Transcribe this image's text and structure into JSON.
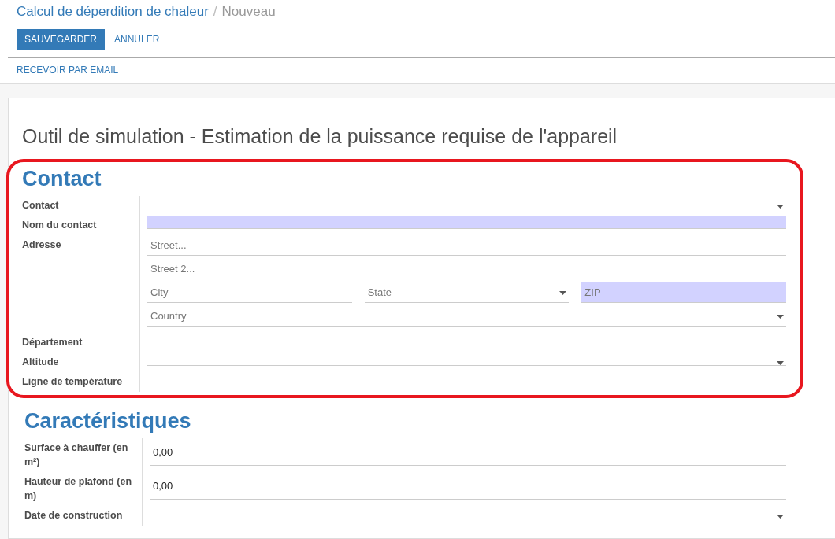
{
  "breadcrumb": {
    "parent": "Calcul de déperdition de chaleur",
    "separator": "/",
    "current": "Nouveau"
  },
  "buttons": [
    {
      "label": "SAUVEGARDER",
      "kind": "primary"
    },
    {
      "label": "ANNULER",
      "kind": "link"
    }
  ],
  "actions": [
    "RECEVOIR PAR EMAIL"
  ],
  "form": {
    "title": "Outil de simulation - Estimation de la puissance requise de l'appareil",
    "sections": [
      {
        "heading": "Contact",
        "highlighted": true,
        "fields": [
          {
            "label": "Contact",
            "kind": "select",
            "required": false
          },
          {
            "label": "Nom du contact",
            "kind": "text",
            "required": true
          },
          {
            "label": "Adresse",
            "kind": "address",
            "rows": [
              [
                {
                  "placeholder": "Street...",
                  "kind": "text",
                  "required": false
                }
              ],
              [
                {
                  "placeholder": "Street 2...",
                  "kind": "text",
                  "required": false
                }
              ],
              [
                {
                  "placeholder": "City",
                  "kind": "text",
                  "required": false
                },
                {
                  "placeholder": "State",
                  "kind": "select",
                  "required": false
                },
                {
                  "placeholder": "ZIP",
                  "kind": "text",
                  "required": true
                }
              ],
              [
                {
                  "placeholder": "Country",
                  "kind": "select",
                  "required": false
                }
              ]
            ]
          },
          {
            "label": "Département",
            "kind": "empty"
          },
          {
            "label": "Altitude",
            "kind": "select",
            "required": false
          },
          {
            "label": "Ligne de température",
            "kind": "empty"
          }
        ]
      },
      {
        "heading": "Caractéristiques",
        "highlighted": false,
        "fields": [
          {
            "label": "Surface à chauffer (en m²)",
            "kind": "text",
            "required": false,
            "value": "0,00"
          },
          {
            "label": "Hauteur de plafond (en m)",
            "kind": "text",
            "required": false,
            "value": "0,00"
          },
          {
            "label": "Date de construction",
            "kind": "select",
            "required": false
          }
        ]
      }
    ]
  }
}
